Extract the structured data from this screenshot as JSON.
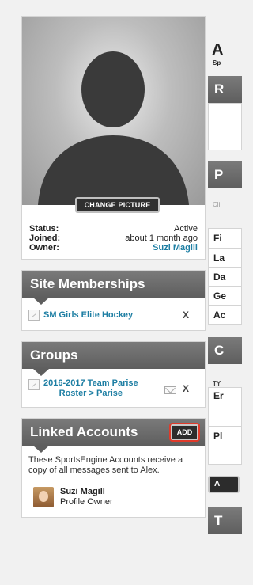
{
  "profile": {
    "change_picture_label": "CHANGE PICTURE",
    "status_label": "Status:",
    "status_value": "Active",
    "joined_label": "Joined:",
    "joined_value": "about 1 month ago",
    "owner_label": "Owner:",
    "owner_value": "Suzi Magill"
  },
  "site_memberships": {
    "title": "Site Memberships",
    "items": [
      {
        "label": "SM Girls Elite Hockey",
        "remove": "X"
      }
    ]
  },
  "groups": {
    "title": "Groups",
    "items": [
      {
        "line1": "2016-2017 Team Parise",
        "line2": "Roster > Parise",
        "remove": "X"
      }
    ]
  },
  "linked_accounts": {
    "title": "Linked Accounts",
    "add_label": "ADD",
    "description": "These SportsEngine Accounts receive a copy of all messages sent to Alex.",
    "accounts": [
      {
        "name": "Suzi Magill",
        "role": "Profile Owner"
      }
    ]
  },
  "right_column": {
    "title_initial": "A",
    "subtitle_fragment": "Sp",
    "section1_initial": "R",
    "section2_initial": "P",
    "small_label": "Cli",
    "rows": [
      "Fi",
      "La",
      "Da",
      "Ge",
      "Ac"
    ],
    "section3_initial": "C",
    "type_label": "TY",
    "contact_rows": [
      "Er",
      "Pl"
    ],
    "button_initial": "A",
    "section4_initial": "T"
  }
}
